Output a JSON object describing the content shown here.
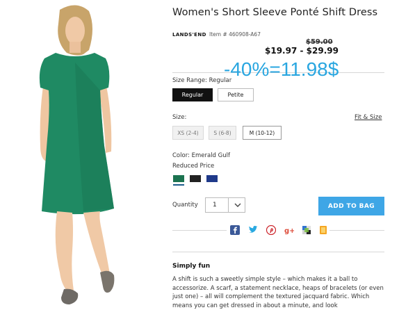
{
  "product": {
    "title": "Women's Short Sleeve Ponté Shift Dress",
    "brand": "LANDS'END",
    "item_number": "Item # 460908-A67",
    "original_price": "$59.00",
    "price_range": "$19.97 - $29.99"
  },
  "overlay_text": "-40%=11.98$",
  "size_range": {
    "label": "Size Range: Regular",
    "options": [
      "Regular",
      "Petite"
    ],
    "selected": "Regular"
  },
  "size": {
    "label": "Size:",
    "fit_link": "Fit & Size",
    "options": [
      "XS (2-4)",
      "S (6-8)",
      "M (10-12)"
    ],
    "selected": "M (10-12)"
  },
  "color": {
    "label": "Color: Emerald Gulf",
    "note": "Reduced Price",
    "swatches": [
      {
        "name": "emerald",
        "hex": "#1c7350"
      },
      {
        "name": "black",
        "hex": "#222222"
      },
      {
        "name": "navy",
        "hex": "#1f3a8a"
      }
    ]
  },
  "quantity": {
    "label": "Quantity",
    "value": "1"
  },
  "add_to_bag_label": "ADD TO BAG",
  "social_icons": [
    "facebook-icon",
    "twitter-icon",
    "pinterest-icon",
    "google-plus-icon",
    "delicious-icon",
    "bookmark-icon"
  ],
  "description": {
    "title": "Simply fun",
    "text": "A shift is such a sweetly simple style – which makes it a ball to accessorize. A scarf, a statement necklace, heaps of bracelets (or even just one) – all will complement the textured jacquard fabric. Which means you can get dressed in about a minute, and look"
  },
  "colors": {
    "accent": "#3ea6e6",
    "overlay": "#29a6e0",
    "dress": "#1f8a63"
  }
}
